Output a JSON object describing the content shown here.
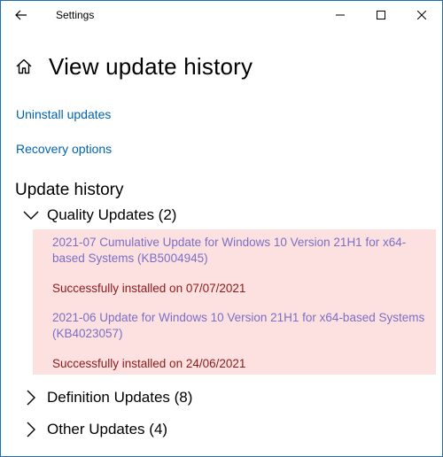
{
  "window": {
    "title": "Settings"
  },
  "header": {
    "title": "View update history"
  },
  "links": {
    "uninstall": "Uninstall updates",
    "recovery": "Recovery options"
  },
  "section": {
    "title": "Update history"
  },
  "groups": [
    {
      "label": "Quality Updates (2)",
      "expanded": true,
      "items": [
        {
          "title": "2021-07 Cumulative Update for Windows 10 Version 21H1 for x64-based Systems (KB5004945)",
          "status": "Successfully installed on 07/07/2021"
        },
        {
          "title": "2021-06 Update for Windows 10 Version 21H1 for x64-based Systems (KB4023057)",
          "status": "Successfully installed on 24/06/2021"
        }
      ]
    },
    {
      "label": "Definition Updates (8)",
      "expanded": false
    },
    {
      "label": "Other Updates (4)",
      "expanded": false
    }
  ],
  "colors": {
    "link": "#0063b1",
    "highlight_bg": "#fde1e1",
    "update_title": "#7a6fc4",
    "status_text": "#8b1a1a",
    "window_border": "#1f6fb5"
  },
  "icons": {
    "back": "back-arrow-icon",
    "home": "home-icon",
    "minimize": "minimize-icon",
    "maximize": "maximize-icon",
    "close": "close-icon",
    "expanded": "chevron-down-icon",
    "collapsed": "chevron-right-icon"
  }
}
